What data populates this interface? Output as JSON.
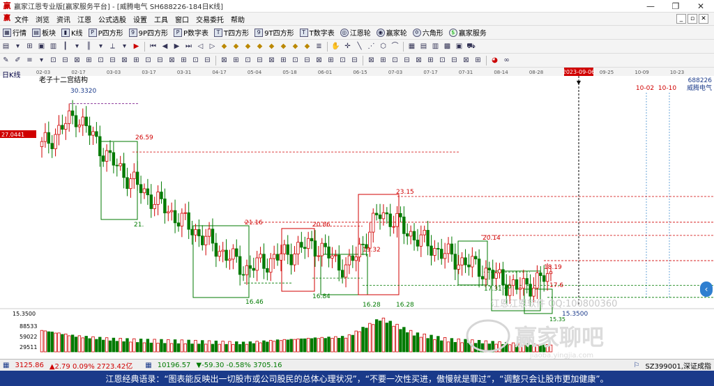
{
  "window": {
    "title": "赢家江恩专业版[赢家服务平台] - [威腾电气  SH688226-184日K线]",
    "min": "—",
    "max": "❐",
    "close": "✕"
  },
  "menu": [
    "文件",
    "浏览",
    "资讯",
    "江恩",
    "公式选股",
    "设置",
    "工具",
    "窗口",
    "交易委托",
    "帮助"
  ],
  "toolbar": [
    "行情",
    "板块",
    "K线",
    "P四方形",
    "9P四方形",
    "P数字表",
    "T四方形",
    "9T四方形",
    "T数字表",
    "江恩轮",
    "赢家轮",
    "六角形",
    "赢家服务"
  ],
  "chart": {
    "period_label": "日K线",
    "structure_label": "老子十二宫结构",
    "stock_code": "688226",
    "stock_name": "威腾电气",
    "date_markers": [
      "10-02",
      "10-10"
    ],
    "highlighted_date": "2023-09-06",
    "current_price_tag": "27.0441",
    "price_low_label": "15.3500",
    "volume_ticks": [
      "88533",
      "59022",
      "29511"
    ],
    "watermark_text": "江恩江恩软件  QQ:100800360",
    "watermark_logo": "赢家聊吧",
    "watermark_url": "jiaoba.yingjia.com",
    "date_axis": [
      "02-03",
      "02-17",
      "03-03",
      "03-17",
      "03-31",
      "04-17",
      "05-04",
      "05-18",
      "06-01",
      "06-15",
      "07-03",
      "07-17",
      "07-31",
      "08-14",
      "08-28",
      "2023-09-06",
      "09-25",
      "10-09",
      "10-23"
    ],
    "annotations": [
      "30.3320",
      "26.59",
      "21.",
      "21.16",
      "20.86",
      "23.15",
      "19.32",
      "20.14",
      "18.19",
      "17.31",
      "17.6",
      "16.46",
      "16.84",
      "16.28",
      "16.28",
      "15.35",
      "15.3500",
      "10"
    ]
  },
  "chart_data": {
    "type": "candlestick",
    "ticker": "SH688226",
    "name": "威腾电气",
    "x": [
      "02-03",
      "02-17",
      "03-03",
      "03-17",
      "03-31",
      "04-17",
      "05-04",
      "05-18",
      "06-01",
      "06-15",
      "07-03",
      "07-17",
      "07-31",
      "08-14",
      "08-28",
      "09-06"
    ],
    "close": [
      27.0,
      29.5,
      26.0,
      23.5,
      21.5,
      19.5,
      17.5,
      18.5,
      19.5,
      17.5,
      22.0,
      20.0,
      18.5,
      17.5,
      16.0,
      17.0
    ],
    "volume": [
      55000,
      40000,
      32000,
      28000,
      26000,
      24000,
      22000,
      30000,
      35000,
      38000,
      85000,
      45000,
      30000,
      25000,
      20000,
      18000
    ],
    "levels": [
      30.332,
      26.59,
      21.16,
      20.86,
      23.15,
      20.14,
      18.19,
      17.31,
      16.46,
      16.84,
      16.28,
      15.35
    ],
    "ylim": [
      14.8,
      31.5
    ],
    "volume_ylim": [
      0,
      100000
    ],
    "series": [
      {
        "name": "威腾电气",
        "values": [
          27.0,
          29.5,
          26.0,
          23.5,
          21.5,
          19.5,
          17.5,
          18.5,
          19.5,
          17.5,
          22.0,
          20.0,
          18.5,
          17.5,
          16.0,
          17.0
        ]
      }
    ]
  },
  "status": {
    "idx1": "3125.86",
    "idx1_change": "▲2.79 0.09% 2723.42亿",
    "idx2": "10196.57",
    "idx2_change": "▼-59.30 -0.58% 3705.16",
    "right": "SZ399001,深证成指"
  },
  "quote": "江恩经典语录：“图表能反映出一切股市或公司股民的总体心理状况”，“不要一次性买进，傲慢就是罪过”，“调整只会让股市更加健康”。",
  "colors": {
    "up": "#d00000",
    "down": "#007a00",
    "menu_bg": "#f4f4f4",
    "quote_bg": "#1a3a8a",
    "price_tag": "#d00000"
  }
}
